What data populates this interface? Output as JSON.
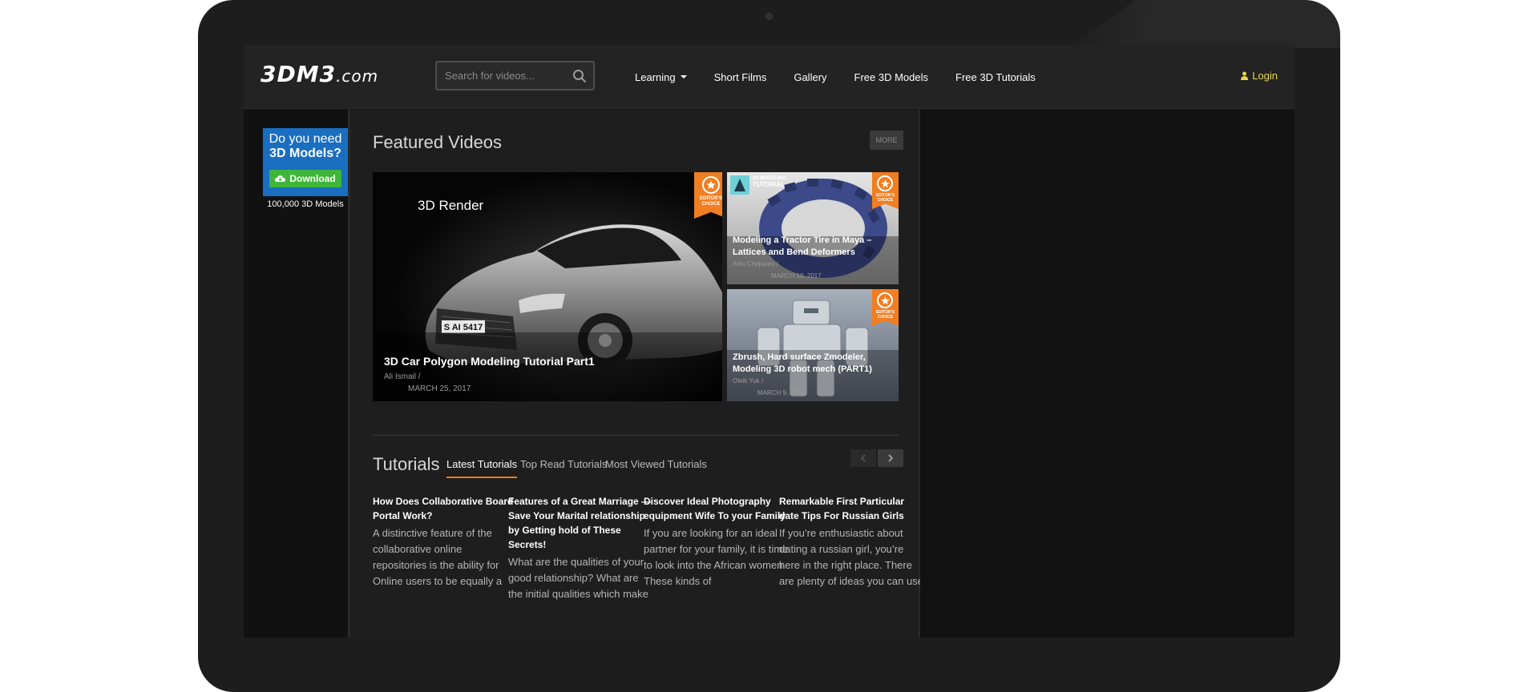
{
  "brand": {
    "logo_main": "3DM3",
    "logo_suffix": ".com"
  },
  "search": {
    "placeholder": "Search for videos..."
  },
  "nav": {
    "items": [
      {
        "label": "Learning",
        "has_dropdown": true
      },
      {
        "label": "Short Films"
      },
      {
        "label": "Gallery"
      },
      {
        "label": "Free 3D Models"
      },
      {
        "label": "Free 3D Tutorials"
      }
    ],
    "login_label": "Login"
  },
  "ad": {
    "line1": "Do you need",
    "line2": "3D Models?",
    "button_label": "Download",
    "caption": "100,000 3D Models"
  },
  "featured": {
    "section_title": "Featured Videos",
    "more_label": "MORE",
    "badge_text_line1": "EDITOR'S",
    "badge_text_line2": "CHOICE",
    "main": {
      "overlay_label": "3D Render",
      "plate": "S AI 5417",
      "title": "3D Car Polygon Modeling Tutorial Part1",
      "author": "Ali Ismail  /",
      "date": "MARCH 25, 2017"
    },
    "side": [
      {
        "corner_line1": "3D MODELING",
        "corner_line2": "TUTORIAL",
        "title": "Modeling a Tractor Tire in Maya – Lattices and Bend Deformers",
        "author": "Alex Cheparev  /",
        "date": "MARCH 10, 2017"
      },
      {
        "title": "Zbrush, Hard surface Zmodeler, Modeling 3D robot mech (PART1)",
        "author": "Oleik Yuk  /",
        "date": "MARCH 9, 2017"
      }
    ]
  },
  "tutorials": {
    "section_title": "Tutorials",
    "tabs": [
      {
        "label": "Latest Tutorials",
        "active": true
      },
      {
        "label": "Top Read Tutorials"
      },
      {
        "label": "Most Viewed Tutorials"
      }
    ],
    "articles": [
      {
        "title": "How Does Collaborative Board Portal Work?",
        "excerpt": "A distinctive feature of the collaborative online repositories is the ability for Online users to be equally a"
      },
      {
        "title": "Features of a Great Marriage — Save Your Marital relationship by Getting hold of These Secrets!",
        "excerpt": "What are the qualities of your good relationship? What are the initial qualities which make"
      },
      {
        "title": "Discover Ideal Photography equipment Wife To your Family",
        "excerpt": "If you are looking for an ideal partner for your family, it is time to look into the African women. These kinds of"
      },
      {
        "title": "Remarkable First Particular date Tips For Russian Girls",
        "excerpt": "If you’re enthusiastic about dating a russian girl, you’re here in the right place. There are plenty of ideas you can use"
      }
    ]
  },
  "colors": {
    "accent": "#f07e22",
    "login": "#e8d84a",
    "ad_blue": "#1a6ec0",
    "ad_green": "#3fb63a"
  }
}
